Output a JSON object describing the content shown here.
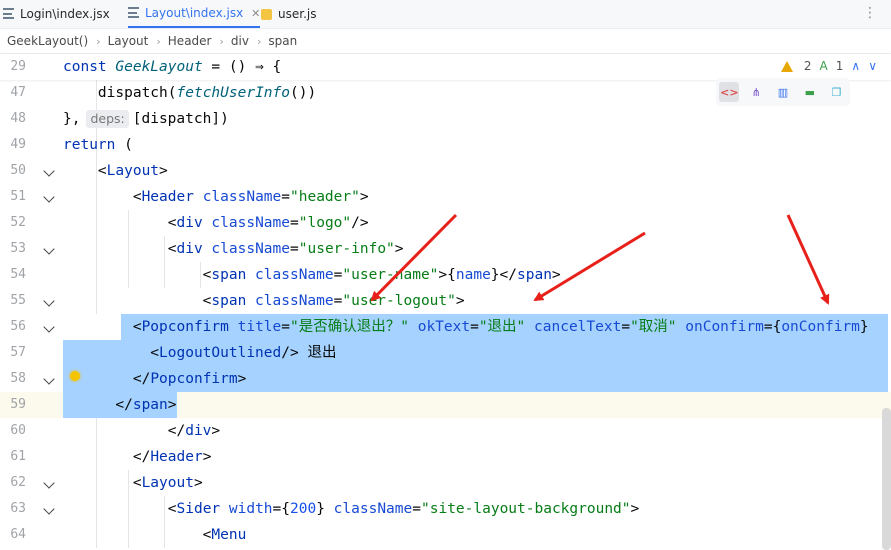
{
  "tabs": [
    {
      "label": "Login\\index.jsx",
      "icon": "jsx-file-icon",
      "active": false
    },
    {
      "label": "Layout\\index.jsx",
      "icon": "jsx-file-icon",
      "active": true
    },
    {
      "label": "user.js",
      "icon": "js-file-icon",
      "active": false
    }
  ],
  "tabbar": {
    "more_label": "⋮"
  },
  "breadcrumb": [
    "GeekLayout()",
    "Layout",
    "Header",
    "div",
    "span"
  ],
  "status": {
    "warnings": "2",
    "typos": "1"
  },
  "lines": [
    {
      "num": "29",
      "tokens": [
        {
          "t": "const ",
          "c": "kw"
        },
        {
          "t": "GeekLayout",
          "c": "fnit"
        },
        {
          "t": " = () ⇒ {",
          "c": ""
        }
      ]
    },
    {
      "num": "47",
      "tokens": [
        {
          "t": "    dispatch(",
          "c": ""
        },
        {
          "t": "fetchUserInfo",
          "c": "fnit"
        },
        {
          "t": "())",
          "c": ""
        }
      ]
    },
    {
      "num": "48",
      "tokens": [
        {
          "t": "},",
          "c": ""
        }
      ],
      "hint": "deps:",
      "after": [
        {
          "t": "[dispatch])",
          "c": ""
        }
      ]
    },
    {
      "num": "49",
      "tokens": [
        {
          "t": "return",
          "c": "kw"
        },
        {
          "t": " (",
          "c": ""
        }
      ]
    },
    {
      "num": "50",
      "tokens": [
        {
          "t": "    <",
          "c": ""
        },
        {
          "t": "Layout",
          "c": "tag"
        },
        {
          "t": ">",
          "c": ""
        }
      ]
    },
    {
      "num": "51",
      "tokens": [
        {
          "t": "        <",
          "c": ""
        },
        {
          "t": "Header",
          "c": "tag"
        },
        {
          "t": " className",
          "c": "attr"
        },
        {
          "t": "=",
          "c": ""
        },
        {
          "t": "\"header\"",
          "c": "str"
        },
        {
          "t": ">",
          "c": ""
        }
      ]
    },
    {
      "num": "52",
      "tokens": [
        {
          "t": "            <",
          "c": ""
        },
        {
          "t": "div",
          "c": "tag"
        },
        {
          "t": " className",
          "c": "attr"
        },
        {
          "t": "=",
          "c": ""
        },
        {
          "t": "\"logo\"",
          "c": "str"
        },
        {
          "t": "/>",
          "c": ""
        }
      ]
    },
    {
      "num": "53",
      "tokens": [
        {
          "t": "            <",
          "c": ""
        },
        {
          "t": "div",
          "c": "tag"
        },
        {
          "t": " className",
          "c": "attr"
        },
        {
          "t": "=",
          "c": ""
        },
        {
          "t": "\"user-info\"",
          "c": "str"
        },
        {
          "t": ">",
          "c": ""
        }
      ]
    },
    {
      "num": "54",
      "tokens": [
        {
          "t": "                <",
          "c": ""
        },
        {
          "t": "span",
          "c": "tag"
        },
        {
          "t": " className",
          "c": "attr"
        },
        {
          "t": "=",
          "c": ""
        },
        {
          "t": "\"user-name\"",
          "c": "str"
        },
        {
          "t": ">{",
          "c": ""
        },
        {
          "t": "name",
          "c": "attr"
        },
        {
          "t": "}</",
          "c": ""
        },
        {
          "t": "span",
          "c": "tag"
        },
        {
          "t": ">",
          "c": ""
        }
      ]
    },
    {
      "num": "55",
      "tokens": [
        {
          "t": "                <",
          "c": ""
        },
        {
          "t": "span",
          "c": "tag"
        },
        {
          "t": " className",
          "c": "attr"
        },
        {
          "t": "=",
          "c": ""
        },
        {
          "t": "\"user-logout\"",
          "c": "str"
        },
        {
          "t": ">",
          "c": ""
        }
      ]
    },
    {
      "num": "56",
      "tokens": [
        {
          "t": "        <",
          "c": ""
        },
        {
          "t": "Popconfirm",
          "c": "tag"
        },
        {
          "t": " title",
          "c": "attr"
        },
        {
          "t": "=",
          "c": ""
        },
        {
          "t": "\"是否确认退出？\"",
          "c": "str"
        },
        {
          "t": " okText",
          "c": "attr"
        },
        {
          "t": "=",
          "c": ""
        },
        {
          "t": "\"退出\"",
          "c": "str"
        },
        {
          "t": " cancelText",
          "c": "attr"
        },
        {
          "t": "=",
          "c": ""
        },
        {
          "t": "\"取消\"",
          "c": "str"
        },
        {
          "t": " onConfirm",
          "c": "attr"
        },
        {
          "t": "={",
          "c": ""
        },
        {
          "t": "onConfirm",
          "c": "attr"
        },
        {
          "t": "}",
          "c": ""
        }
      ]
    },
    {
      "num": "57",
      "tokens": [
        {
          "t": "          <",
          "c": ""
        },
        {
          "t": "LogoutOutlined",
          "c": "tag"
        },
        {
          "t": "/> 退出",
          "c": ""
        }
      ]
    },
    {
      "num": "58",
      "tokens": [
        {
          "t": "        </",
          "c": ""
        },
        {
          "t": "Popconfirm",
          "c": "tag"
        },
        {
          "t": ">",
          "c": ""
        }
      ]
    },
    {
      "num": "59",
      "tokens": [
        {
          "t": "      </",
          "c": ""
        },
        {
          "t": "span",
          "c": "tag"
        },
        {
          "t": ">",
          "c": ""
        }
      ]
    },
    {
      "num": "60",
      "tokens": [
        {
          "t": "            </",
          "c": ""
        },
        {
          "t": "div",
          "c": "tag"
        },
        {
          "t": ">",
          "c": ""
        }
      ]
    },
    {
      "num": "61",
      "tokens": [
        {
          "t": "        </",
          "c": ""
        },
        {
          "t": "Header",
          "c": "tag"
        },
        {
          "t": ">",
          "c": ""
        }
      ]
    },
    {
      "num": "62",
      "tokens": [
        {
          "t": "        <",
          "c": ""
        },
        {
          "t": "Layout",
          "c": "tag"
        },
        {
          "t": ">",
          "c": ""
        }
      ]
    },
    {
      "num": "63",
      "tokens": [
        {
          "t": "            <",
          "c": ""
        },
        {
          "t": "Sider",
          "c": "tag"
        },
        {
          "t": " width",
          "c": "attr"
        },
        {
          "t": "={",
          "c": ""
        },
        {
          "t": "200",
          "c": "num"
        },
        {
          "t": "}",
          "c": ""
        },
        {
          "t": " className",
          "c": "attr"
        },
        {
          "t": "=",
          "c": ""
        },
        {
          "t": "\"site-layout-background\"",
          "c": "str"
        },
        {
          "t": ">",
          "c": ""
        }
      ]
    },
    {
      "num": "64",
      "tokens": [
        {
          "t": "                <",
          "c": ""
        },
        {
          "t": "Menu",
          "c": "tag"
        }
      ]
    }
  ],
  "colors": {
    "selection": "#a6d2ff",
    "keyword": "#0033b3",
    "string": "#067d17",
    "arrow": "#e8201a"
  }
}
